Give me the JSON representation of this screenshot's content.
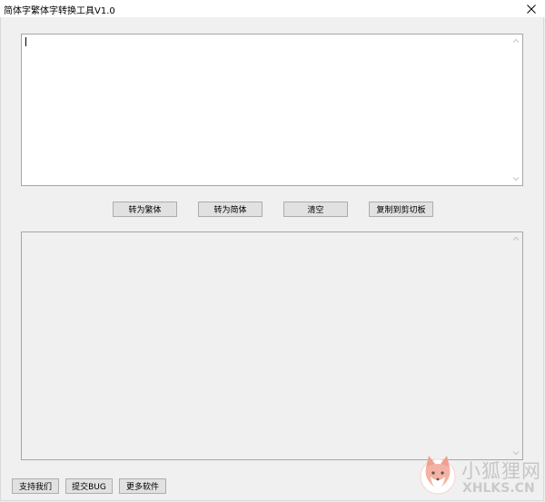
{
  "window": {
    "title": "简体字繁体字转换工具V1.0"
  },
  "input": {
    "value": ""
  },
  "output": {
    "value": ""
  },
  "actions": {
    "to_traditional": "转为繁体",
    "to_simplified": "转为简体",
    "clear": "清空",
    "copy_clipboard": "复制到剪切板"
  },
  "footer": {
    "support": "支持我们",
    "submit_bug": "提交BUG",
    "more_software": "更多软件"
  },
  "watermark": {
    "text_cn": "小狐狸网",
    "text_en": "XHLKS.CN"
  },
  "icons": {
    "close": "close-icon",
    "scroll_up": "chevron-up-icon",
    "scroll_down": "chevron-down-icon",
    "fox": "fox-logo"
  }
}
